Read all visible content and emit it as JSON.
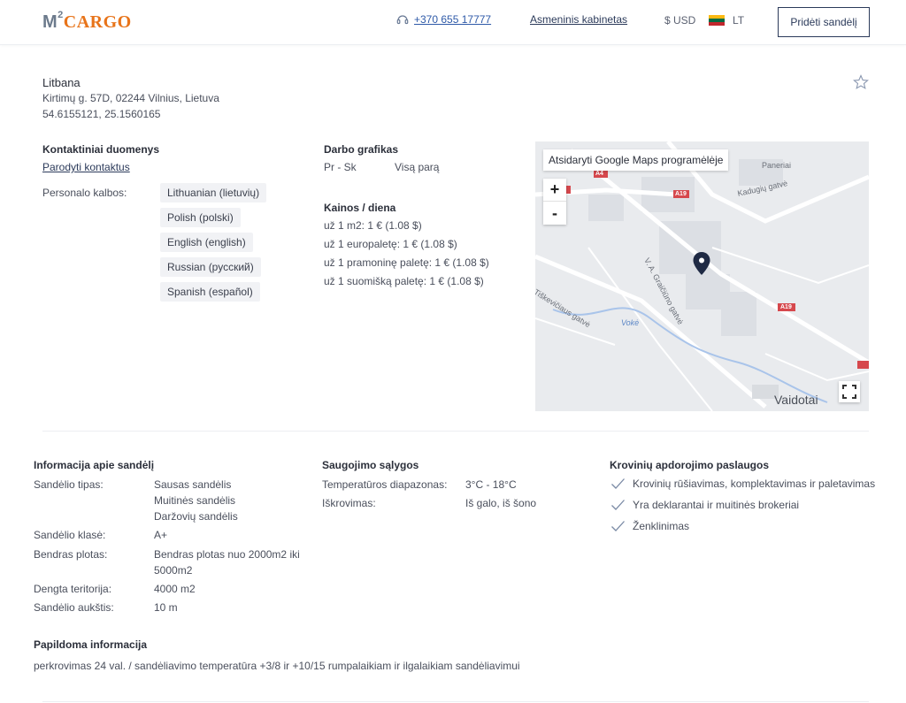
{
  "header": {
    "logo_m": "M",
    "logo_sup": "2",
    "logo_cargo": "CARGO",
    "phone": "+370 655 17777",
    "cabinet": "Asmeninis kabinetas",
    "currency": "$ USD",
    "language": "LT",
    "add_button": "Pridėti sandėlį",
    "flag_colors": [
      "#fdb913",
      "#006a44",
      "#c1272d"
    ]
  },
  "warehouse": {
    "name": "Litbana",
    "address": "Kirtimų g. 57D, 02244 Vilnius, Lietuva",
    "coords": "54.6155121, 25.1560165"
  },
  "contacts": {
    "title": "Kontaktiniai duomenys",
    "show_link": "Parodyti kontaktus",
    "languages_label": "Personalo kalbos:",
    "languages": [
      "Lithuanian (lietuvių)",
      "Polish (polski)",
      "English (english)",
      "Russian (русский)",
      "Spanish (español)"
    ]
  },
  "schedule": {
    "title": "Darbo grafikas",
    "days": "Pr - Sk",
    "hours": "Visą parą"
  },
  "prices": {
    "title": "Kainos / diena",
    "items": [
      "už 1 m2:  1 € (1.08 $)",
      "už 1 europaletę:  1 € (1.08 $)",
      "už 1 pramoninę paletę:  1 € (1.08 $)",
      "už 1 suomišką paletę:  1 € (1.08 $)"
    ]
  },
  "map": {
    "open_label": "Atsidaryti Google Maps programėlėje",
    "zoom_in": "+",
    "zoom_out": "-",
    "labels": {
      "paneriai": "Paneriai",
      "kaduglu": "Kadugių  gatvė",
      "graiciuno": "V. A. Graičiūno  gatvė",
      "tiskeviciaus": "Tiškevičiaus  gatvė",
      "voke": "Vokė",
      "vaidotai": "Vaidotai",
      "a4": "A4",
      "a19a": "A19",
      "a19b": "A19"
    }
  },
  "info": {
    "title": "Informacija apie sandėlį",
    "type_label": "Sandėlio tipas:",
    "types": [
      "Sausas sandėlis",
      "Muitinės sandėlis",
      "Daržovių sandėlis"
    ],
    "class_label": "Sandėlio klasė:",
    "class_value": "A+",
    "area_label": "Bendras plotas:",
    "area_value_1": "Bendras plotas nuo 2000m2 iki",
    "area_value_2": "5000m2",
    "covered_label": "Dengta teritorija:",
    "covered_value": "4000 m2",
    "height_label": "Sandėlio aukštis:",
    "height_value": "10 m"
  },
  "storage": {
    "title": "Saugojimo sąlygos",
    "temp_label": "Temperatūros diapazonas:",
    "temp_value": "3°C - 18°C",
    "unload_label": "Iškrovimas:",
    "unload_value": "Iš galo, iš šono"
  },
  "services": {
    "title": "Krovinių apdorojimo paslaugos",
    "items": [
      "Krovinių rūšiavimas, komplektavimas ir paletavimas",
      "Yra deklarantai ir muitinės brokeriai",
      "Ženklinimas"
    ]
  },
  "extra": {
    "title": "Papildoma informacija",
    "text": "perkrovimas 24 val. / sandėliavimo temperatūra +3/8 ir +10/15 rumpalaikiam ir ilgalaikiam sandėliavimui"
  }
}
